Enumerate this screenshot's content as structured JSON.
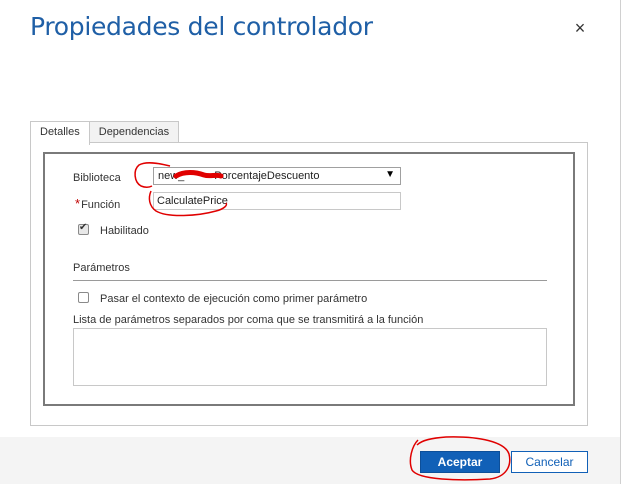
{
  "dialog": {
    "title": "Propiedades del controlador",
    "close_icon": "close-icon",
    "close_glyph": "×"
  },
  "tabs": [
    {
      "label": "Detalles",
      "active": true
    },
    {
      "label": "Dependencias",
      "active": false
    }
  ],
  "form": {
    "biblioteca_label": "Biblioteca",
    "biblioteca_value": "new_",
    "biblioteca_value_tail": "PorcentajeDescuento",
    "funcion_required_mark": "*",
    "funcion_label": "Función",
    "funcion_value": "CalculatePrice",
    "habilitado_label": "Habilitado",
    "habilitado_checked": true,
    "parametros_heading": "Parámetros",
    "pasar_contexto_label": "Pasar el contexto de ejecución como primer parámetro",
    "pasar_contexto_checked": false,
    "lista_parametros_label": "Lista de parámetros separados por coma que se transmitirá a la función",
    "lista_parametros_value": ""
  },
  "footer": {
    "accept_label": "Aceptar",
    "cancel_label": "Cancelar"
  },
  "colors": {
    "title": "#1f5fa6",
    "primary_button": "#1160b7",
    "required": "#c00000",
    "annotation": "#e00000"
  }
}
